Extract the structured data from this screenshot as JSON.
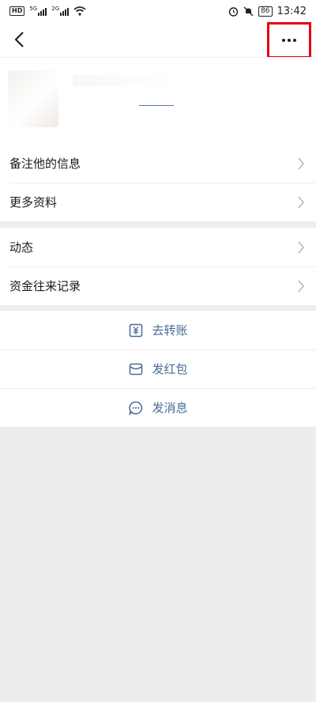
{
  "status_bar": {
    "network_badge": "HD",
    "sim1_label": "5G",
    "sim2_label": "2G",
    "battery": "86",
    "time": "13:42"
  },
  "nav": {
    "back_icon": "chevron-left-icon",
    "more_icon": "more-dots-icon",
    "highlight_color": "#e60012"
  },
  "menu_group_1": [
    {
      "label": "备注他的信息"
    },
    {
      "label": "更多资料"
    }
  ],
  "menu_group_2": [
    {
      "label": "动态"
    },
    {
      "label": "资金往来记录"
    }
  ],
  "actions": [
    {
      "label": "去转账",
      "icon": "transfer-yuan-icon"
    },
    {
      "label": "发红包",
      "icon": "red-packet-icon"
    },
    {
      "label": "发消息",
      "icon": "message-bubble-icon"
    }
  ],
  "colors": {
    "action_text": "#4a6a96",
    "background": "#ededed"
  }
}
